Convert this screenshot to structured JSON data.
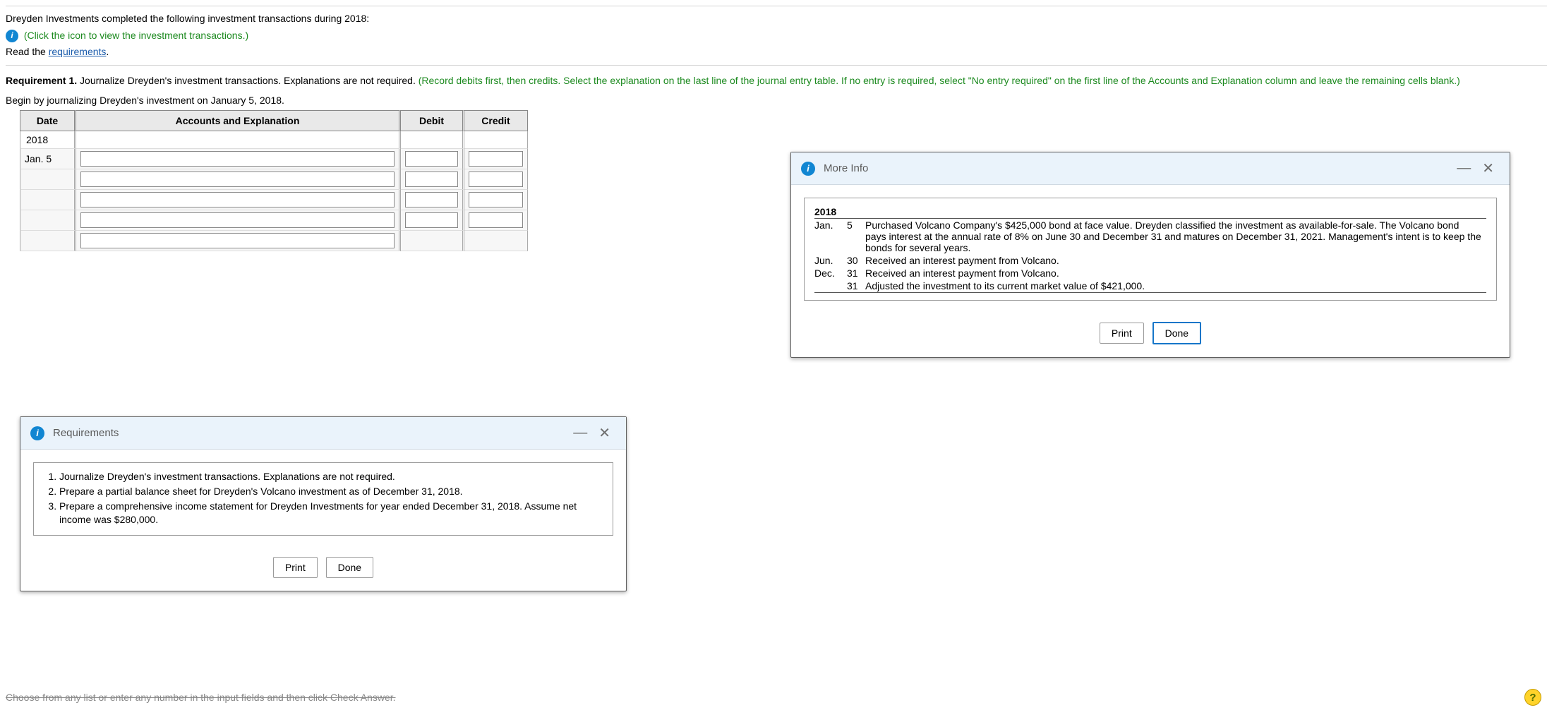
{
  "preamble": {
    "intro": "Dreyden Investments completed the following investment transactions during 2018:",
    "click_hint": "(Click the icon to view the investment transactions.)",
    "read_prefix": "Read the ",
    "requirements_link": "requirements",
    "read_suffix": "."
  },
  "req1": {
    "label": "Requirement 1.",
    "text": " Journalize Dreyden's investment transactions. Explanations are not required. ",
    "hint": "(Record debits first, then credits. Select the explanation on the last line of the journal entry table. If no entry is required, select \"No entry required\" on the first line of the Accounts and Explanation column and leave the remaining cells blank.)"
  },
  "begin": "Begin by journalizing Dreyden's investment on January 5, 2018.",
  "journal": {
    "headers": {
      "date": "Date",
      "accounts": "Accounts and Explanation",
      "debit": "Debit",
      "credit": "Credit"
    },
    "year": "2018",
    "first_date": "Jan. 5"
  },
  "more_info": {
    "title": "More Info",
    "year": "2018",
    "rows": [
      {
        "mon": "Jan.",
        "day": "5",
        "desc": "Purchased Volcano Company's $425,000 bond at face value. Dreyden classified the investment as available-for-sale. The Volcano bond pays interest at the annual rate of 8% on June 30 and December 31 and matures on December 31, 2021. Management's intent is to keep the bonds for several years."
      },
      {
        "mon": "Jun.",
        "day": "30",
        "desc": "Received an interest payment from Volcano."
      },
      {
        "mon": "Dec.",
        "day": "31",
        "desc": "Received an interest payment from Volcano."
      },
      {
        "mon": "",
        "day": "31",
        "desc": "Adjusted the investment to its current market value of $421,000."
      }
    ],
    "print": "Print",
    "done": "Done"
  },
  "requirements": {
    "title": "Requirements",
    "items": [
      "Journalize Dreyden's investment transactions. Explanations are not required.",
      "Prepare a partial balance sheet for Dreyden's Volcano investment as of December 31, 2018.",
      "Prepare a comprehensive income statement for Dreyden Investments for year ended December 31, 2018. Assume net income was $280,000."
    ],
    "print": "Print",
    "done": "Done"
  },
  "footer_hint": "Choose from any list or enter any number in the input fields and then click Check Answer.",
  "icons": {
    "info_glyph": "i",
    "minimize": "—",
    "close": "✕",
    "help": "?"
  }
}
